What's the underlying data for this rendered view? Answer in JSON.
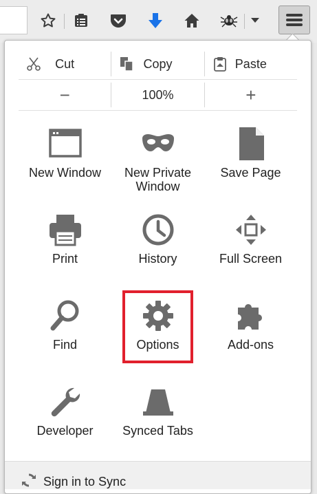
{
  "toolbar": {
    "buttons": [
      {
        "name": "bookmark-star",
        "icon": "star-icon"
      },
      {
        "name": "reading-list",
        "icon": "reading-list-icon"
      },
      {
        "name": "pocket",
        "icon": "pocket-icon"
      },
      {
        "name": "downloads",
        "icon": "download-icon"
      },
      {
        "name": "home",
        "icon": "home-icon"
      },
      {
        "name": "extension",
        "icon": "bug-icon"
      },
      {
        "name": "overflow",
        "icon": "chevron-down-icon"
      }
    ],
    "colors": {
      "download_arrow": "#1a73e8",
      "icon_gray": "#3d3d3d"
    },
    "menu_button_icon": "hamburger-icon"
  },
  "edit_row": {
    "cut_label": "Cut",
    "copy_label": "Copy",
    "paste_label": "Paste"
  },
  "zoom_row": {
    "zoom_out": "−",
    "zoom_level": "100%",
    "zoom_in": "+"
  },
  "items": {
    "new_window": "New Window",
    "new_private_window_l1": "New Private",
    "new_private_window_l2": "Window",
    "save_page": "Save Page",
    "print": "Print",
    "history": "History",
    "full_screen": "Full Screen",
    "find": "Find",
    "options": "Options",
    "addons": "Add-ons",
    "developer": "Developer",
    "synced_tabs": "Synced Tabs"
  },
  "footer": {
    "sign_in_label": "Sign in to Sync"
  },
  "highlight_color": "#e1202d"
}
